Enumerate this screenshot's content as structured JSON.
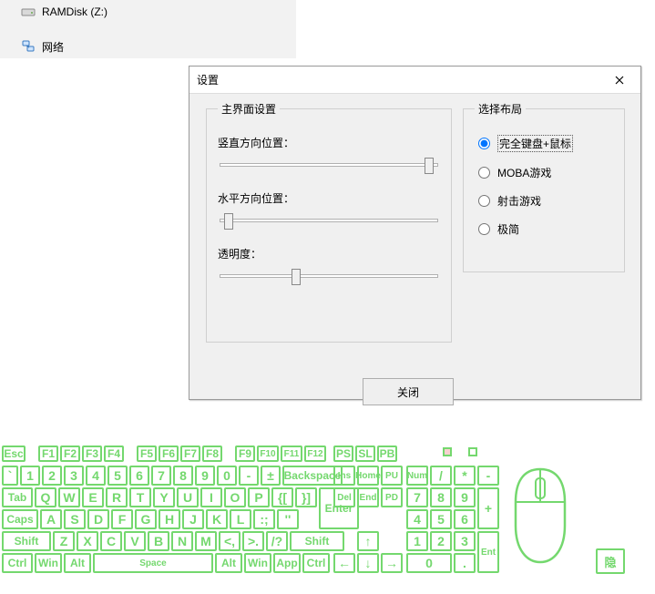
{
  "sidebar": {
    "items": [
      {
        "label": "RAMDisk (Z:)",
        "icon": "drive"
      },
      {
        "label": "网络",
        "icon": "network"
      }
    ]
  },
  "dialog": {
    "title": "设置",
    "main_group": {
      "legend": "主界面设置",
      "vertical_label": "竖直方向位置：",
      "horizontal_label": "水平方向位置：",
      "opacity_label": "透明度：",
      "vertical_pos": 0.97,
      "horizontal_pos": 0.02,
      "opacity_pos": 0.34
    },
    "layout_group": {
      "legend": "选择布局",
      "options": [
        "完全键盘+鼠标",
        "MOBA游戏",
        "射击游戏",
        "极简"
      ],
      "selected": 0
    },
    "close_label": "关闭"
  },
  "keyboard": {
    "color": "#74d86e",
    "hide_label": "隐",
    "rows": {
      "fn": [
        "Esc",
        "F1",
        "F2",
        "F3",
        "F4",
        "F5",
        "F6",
        "F7",
        "F8",
        "F9",
        "F10",
        "F11",
        "F12",
        "PS",
        "SL",
        "PB"
      ],
      "num": [
        "`",
        "1",
        "2",
        "3",
        "4",
        "5",
        "6",
        "7",
        "8",
        "9",
        "0",
        "-",
        "±",
        "Backspace",
        "Ins",
        "Home",
        "PU",
        "Num",
        "/",
        "*",
        "-"
      ],
      "qw": [
        "Tab",
        "Q",
        "W",
        "E",
        "R",
        "T",
        "Y",
        "U",
        "I",
        "O",
        "P",
        "{[",
        "}]",
        "Enter",
        "Del",
        "End",
        "PD",
        "7",
        "8",
        "9",
        "+"
      ],
      "as": [
        "Caps",
        "A",
        "S",
        "D",
        "F",
        "G",
        "H",
        "J",
        "K",
        "L",
        ":;",
        "''",
        "4",
        "5",
        "6"
      ],
      "zx": [
        "Shift",
        "Z",
        "X",
        "C",
        "V",
        "B",
        "N",
        "M",
        "<,",
        ">.",
        "/?",
        "Shift",
        "↑",
        "1",
        "2",
        "3",
        "Ent"
      ],
      "ctrl": [
        "Ctrl",
        "Win",
        "Alt",
        "Space",
        "Alt",
        "Win",
        "App",
        "Ctrl",
        "←",
        "↓",
        "→",
        "0",
        "."
      ]
    }
  }
}
